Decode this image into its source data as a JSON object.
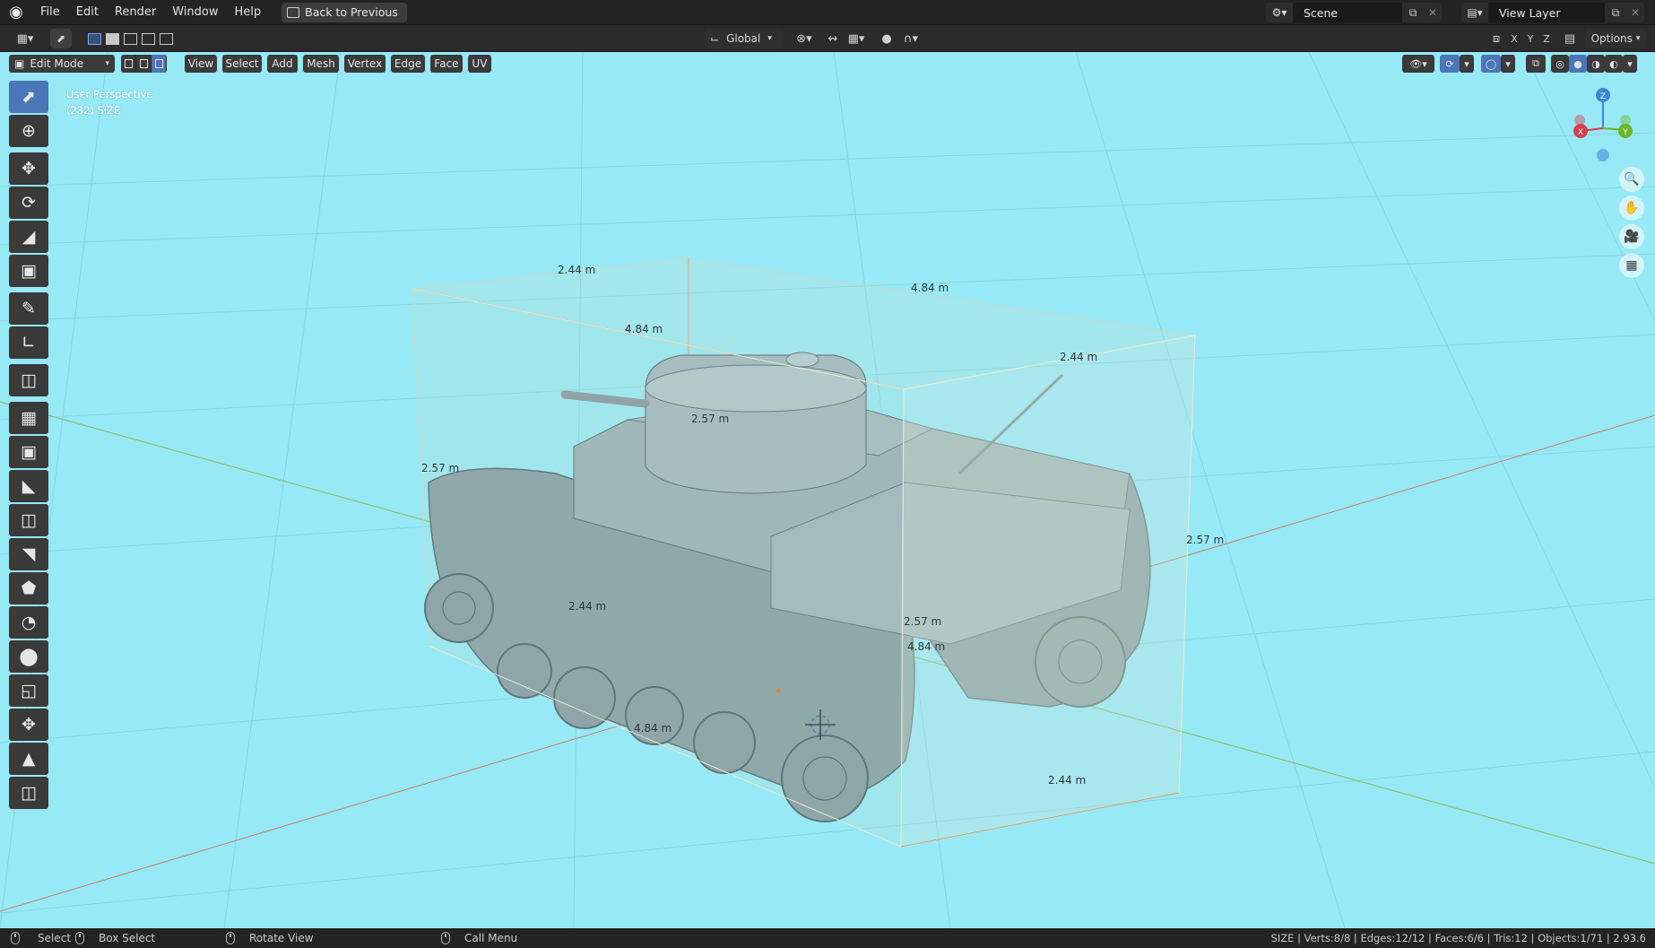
{
  "menubar": {
    "items": [
      "File",
      "Edit",
      "Render",
      "Window",
      "Help"
    ],
    "back_button": "Back to Previous",
    "scene_name": "Scene",
    "view_layer": "View Layer"
  },
  "toolbar": {
    "transform_orientation": "Global",
    "axes": [
      "X",
      "Y",
      "Z"
    ],
    "options_label": "Options"
  },
  "viewport_header": {
    "mode": "Edit Mode",
    "menus": [
      "View",
      "Select",
      "Add",
      "Mesh",
      "Vertex",
      "Edge",
      "Face",
      "UV"
    ]
  },
  "viewport": {
    "perspective_label": "User Perspective",
    "object_label": "(232) SIZE",
    "background_color": "#97e9f6",
    "dimensions": {
      "d1": "2.44 m",
      "d2": "4.84 m",
      "d3": "4.84 m",
      "d4": "2.44 m",
      "d5": "2.57 m",
      "d6": "2.57 m",
      "d7": "2.57 m",
      "d8": "2.44 m",
      "d9": "2.57 m",
      "d10": "4.84 m",
      "d11": "4.84 m",
      "d12": "2.44 m"
    },
    "gizmo_axes": [
      "X",
      "Y",
      "Z"
    ]
  },
  "statusbar": {
    "select": "Select",
    "box_select": "Box Select",
    "rotate_view": "Rotate View",
    "call_menu": "Call Menu",
    "stats": "SIZE | Verts:8/8 | Edges:12/12 | Faces:6/6 | Tris:12 | Objects:1/71 | 2.93.6"
  }
}
